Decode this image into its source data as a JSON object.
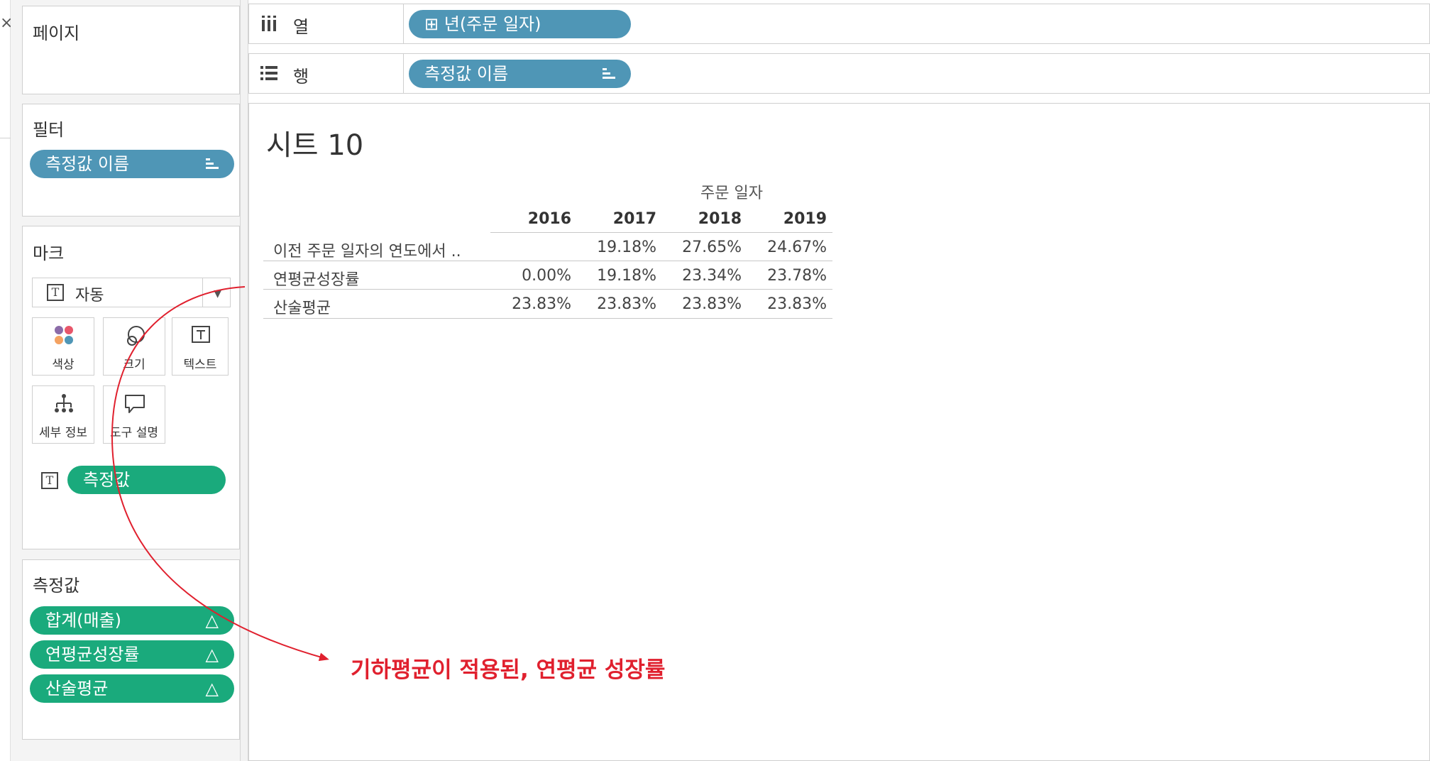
{
  "colors": {
    "blue_pill": "#4f96b6",
    "green_pill": "#1aaa7c",
    "annotation": "#e0202e"
  },
  "sidebar": {
    "pages": {
      "title": "페이지"
    },
    "filters": {
      "title": "필터",
      "pill": "측정값 이름"
    },
    "marks": {
      "title": "마크",
      "type_dropdown": "자동",
      "buttons": {
        "color": "색상",
        "size": "크기",
        "text": "텍스트",
        "detail": "세부 정보",
        "tooltip": "도구 설명"
      },
      "text_field_pill": "측정값"
    },
    "measure_values": {
      "title": "측정값",
      "items": [
        {
          "label": "합계(매출)",
          "icon": "delta-icon"
        },
        {
          "label": "연평균성장률",
          "icon": "delta-icon"
        },
        {
          "label": "산술평균",
          "icon": "delta-icon"
        }
      ]
    }
  },
  "shelves": {
    "columns": {
      "label": "열",
      "pill": "⊞ 년(주문 일자)"
    },
    "rows": {
      "label": "행",
      "pill": "측정값 이름"
    }
  },
  "view": {
    "sheet_title": "시트 10",
    "column_group": "주문 일자",
    "years": [
      "2016",
      "2017",
      "2018",
      "2019"
    ],
    "rows": [
      {
        "label": "이전 주문 일자의 연도에서 ..",
        "values": [
          "",
          "19.18%",
          "27.65%",
          "24.67%"
        ]
      },
      {
        "label": "연평균성장률",
        "values": [
          "0.00%",
          "19.18%",
          "23.34%",
          "23.78%"
        ]
      },
      {
        "label": "산술평균",
        "values": [
          "23.83%",
          "23.83%",
          "23.83%",
          "23.83%"
        ]
      }
    ]
  },
  "annotation": {
    "text": "기하평균이 적용된, 연평균 성장률"
  }
}
